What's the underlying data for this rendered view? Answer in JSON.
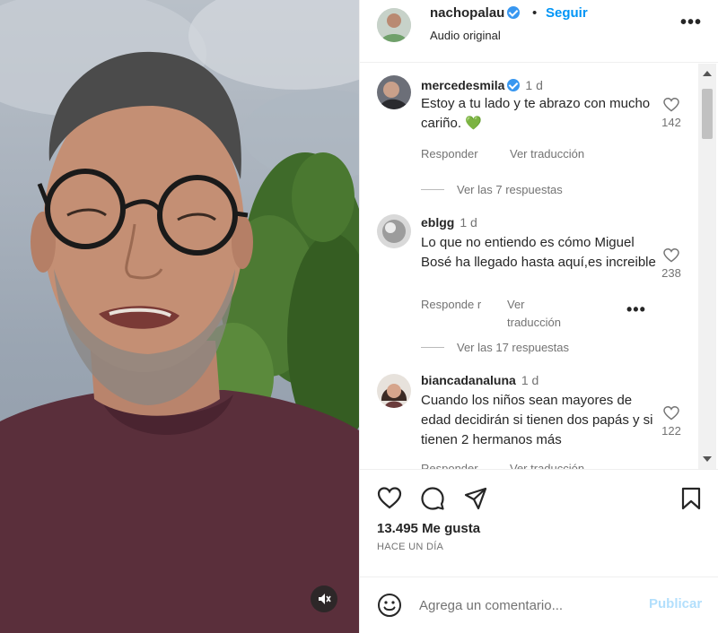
{
  "post": {
    "username": "nachopalau",
    "separator": "•",
    "follow_label": "Seguir",
    "audio_label": "Audio original",
    "more_icon": "more-horizontal-icon"
  },
  "comments": [
    {
      "username": "mercedesmila",
      "verified": true,
      "time": "1 d",
      "text": "Estoy a tu lado y te abrazo con mucho cariño. 💚",
      "likes": "142",
      "reply_label": "Responder",
      "translate_label": "Ver traducción",
      "replies_label": "Ver las 7 respuestas"
    },
    {
      "username": "eblgg",
      "verified": false,
      "time": "1 d",
      "text": "Lo que no entiendo es cómo Miguel Bosé ha llegado hasta aquí,es increible",
      "likes": "238",
      "reply_label": "Responde r",
      "translate_label": "Ver traducción",
      "more": "•••",
      "replies_label": "Ver las 17 respuestas"
    },
    {
      "username": "biancadanaluna",
      "verified": false,
      "time": "1 d",
      "text": "Cuando los niños sean mayores de edad decidirán si tienen dos papás y si tienen 2 hermanos más",
      "likes": "122",
      "reply_label": "Responder",
      "translate_label": "Ver traducción"
    }
  ],
  "actions": {
    "like_icon": "heart-icon",
    "comment_icon": "comment-icon",
    "share_icon": "send-icon",
    "save_icon": "bookmark-icon",
    "likes_count": "13.495",
    "likes_suffix": "Me gusta",
    "time_ago": "HACE UN DÍA"
  },
  "composer": {
    "emoji_icon": "emoji-icon",
    "placeholder": "Agrega un comentario...",
    "publish_label": "Publicar"
  },
  "media": {
    "mute_icon": "speaker-muted-icon"
  },
  "colors": {
    "accent": "#0095f6",
    "publish_disabled": "#b2dffc",
    "verified": "#3897f0",
    "heart_green": "#2eb82e"
  }
}
